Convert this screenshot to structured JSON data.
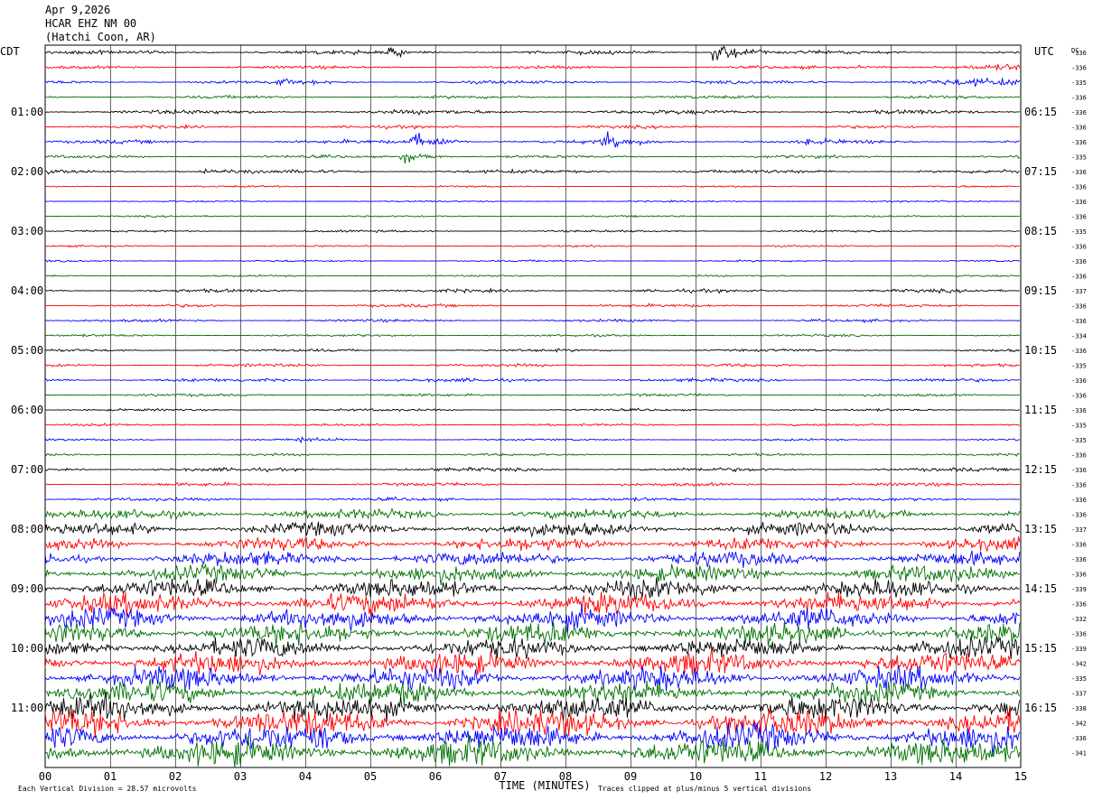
{
  "header": {
    "date": "Apr 9,2026",
    "station": "HCAR EHZ NM 00",
    "location": "(Hatchi Coon, AR)"
  },
  "chart_data": {
    "type": "line",
    "title": "Apr 9,2026",
    "left_axis_label": "CDT",
    "right_axis_label": "UTC",
    "dc_label": "DC",
    "xlabel": "TIME (MINUTES)",
    "x_ticks": [
      "00",
      "01",
      "02",
      "03",
      "04",
      "05",
      "06",
      "07",
      "08",
      "09",
      "10",
      "11",
      "12",
      "13",
      "14",
      "15"
    ],
    "xlim": [
      0,
      15
    ],
    "grid": true,
    "left_hour_labels": [
      "01:00",
      "02:00",
      "03:00",
      "04:00",
      "05:00",
      "06:00",
      "07:00",
      "08:00",
      "09:00",
      "10:00",
      "11:00"
    ],
    "right_hour_labels": [
      "06:15",
      "07:15",
      "08:15",
      "09:15",
      "10:15",
      "11:15",
      "12:15",
      "13:15",
      "14:15",
      "15:15",
      "16:15"
    ],
    "trace_colors": [
      "#000000",
      "#ff0000",
      "#0000ff",
      "#007000"
    ],
    "trace_count": 48,
    "dc_offsets": [
      "-336",
      "-336",
      "-335",
      "-336",
      "-336",
      "-336",
      "-336",
      "-335",
      "-336",
      "-336",
      "-336",
      "-336",
      "-335",
      "-336",
      "-336",
      "-336",
      "-337",
      "-336",
      "-336",
      "-334",
      "-336",
      "-335",
      "-336",
      "-336",
      "-336",
      "-335",
      "-335",
      "-336",
      "-336",
      "-336",
      "-336",
      "-336",
      "-337",
      "-336",
      "-336",
      "-336",
      "-339",
      "-336",
      "-332",
      "-336",
      "-339",
      "-342",
      "-335",
      "-337",
      "-338",
      "-342",
      "-336",
      "-341"
    ],
    "amplitude_levels": [
      1.2,
      1.0,
      1.1,
      1.0,
      1.4,
      1.0,
      1.2,
      1.0,
      1.2,
      0.6,
      0.5,
      0.6,
      0.7,
      0.6,
      0.6,
      0.6,
      1.1,
      1.0,
      0.9,
      0.8,
      0.9,
      1.0,
      1.2,
      0.9,
      0.8,
      0.8,
      0.7,
      0.8,
      1.2,
      1.1,
      1.1,
      3.5,
      4.5,
      4.5,
      5,
      5.5,
      6.5,
      7,
      7,
      7,
      7,
      7.5,
      7.5,
      7.5,
      8.5,
      9,
      9,
      9
    ],
    "events": [
      {
        "trace": 0,
        "minute": 10.3,
        "size": 10
      },
      {
        "trace": 0,
        "minute": 5.3,
        "size": 4
      },
      {
        "trace": 2,
        "minute": 3.6,
        "size": 4
      },
      {
        "trace": 6,
        "minute": 5.65,
        "size": 8
      },
      {
        "trace": 6,
        "minute": 8.6,
        "size": 8
      },
      {
        "trace": 6,
        "minute": 11.7,
        "size": 4
      },
      {
        "trace": 7,
        "minute": 5.5,
        "size": 5
      },
      {
        "trace": 8,
        "minute": 2.4,
        "size": 2
      },
      {
        "trace": 26,
        "minute": 3.9,
        "size": 3
      },
      {
        "trace": 46,
        "minute": 4.1,
        "size": 12
      }
    ],
    "footer_left": "Each Vertical Division =   28.57 microvolts",
    "footer_right": "Traces clipped at plus/minus 5 vertical divisions"
  }
}
